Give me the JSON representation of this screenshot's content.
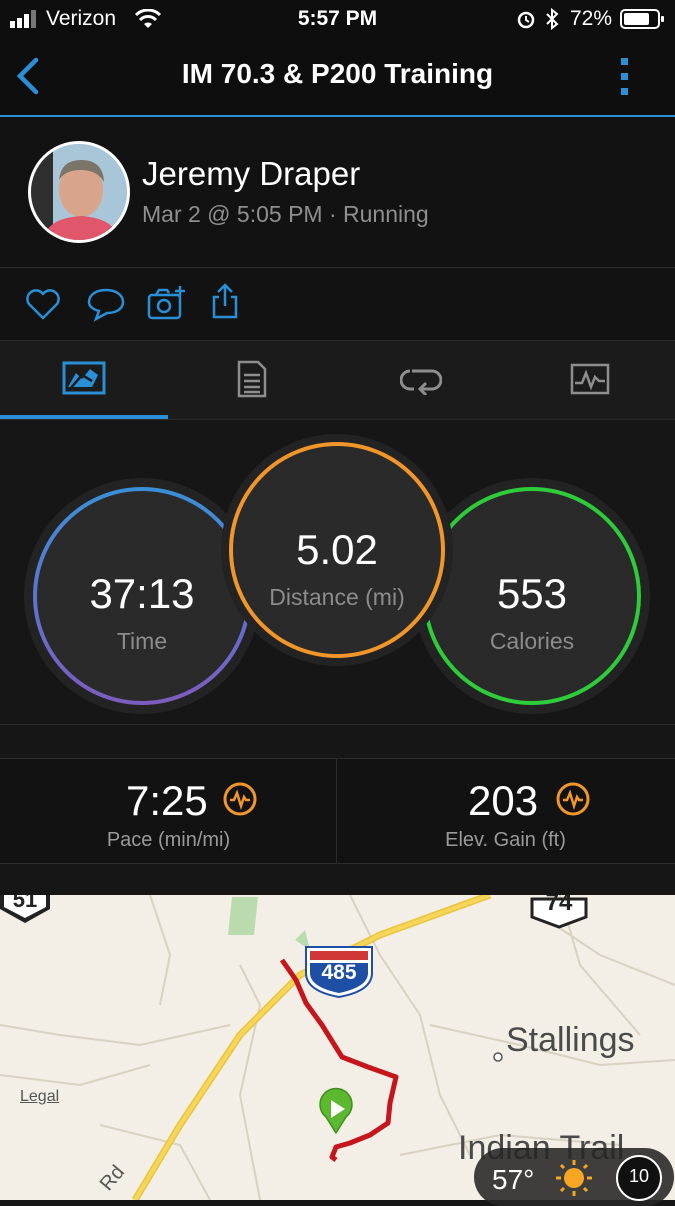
{
  "status_bar": {
    "carrier": "Verizon",
    "time": "5:57 PM",
    "battery": "72%"
  },
  "nav": {
    "title": "IM 70.3 & P200 Training"
  },
  "activity": {
    "name": "Jeremy Draper",
    "meta": "Mar 2 @ 5:05 PM · Running"
  },
  "tabs": [
    {
      "icon": "map-icon",
      "active": true
    },
    {
      "icon": "details-icon",
      "active": false
    },
    {
      "icon": "laps-icon",
      "active": false
    },
    {
      "icon": "chart-icon",
      "active": false
    }
  ],
  "rings": {
    "time": {
      "value": "37:13",
      "label": "Time"
    },
    "distance": {
      "value": "5.02",
      "label": "Distance (mi)"
    },
    "calories": {
      "value": "553",
      "label": "Calories"
    }
  },
  "stats": {
    "pace": {
      "value": "7:25",
      "label": "Pace (min/mi)"
    },
    "elev": {
      "value": "203",
      "label": "Elev. Gain (ft)"
    }
  },
  "map": {
    "legal": "Legal",
    "town1": "Stallings",
    "town2": "Indian Trail",
    "road_fragment": "Rd",
    "route_485": "485",
    "route_74": "74",
    "route_51": "51",
    "weather": {
      "temp": "57°",
      "uv": "10"
    }
  },
  "colors": {
    "accent": "#2a8fd6",
    "time_ring": "#3a8fd8",
    "distance_ring": "#f0962a",
    "calories_ring": "#2ecc3a",
    "route": "#c6161d"
  }
}
